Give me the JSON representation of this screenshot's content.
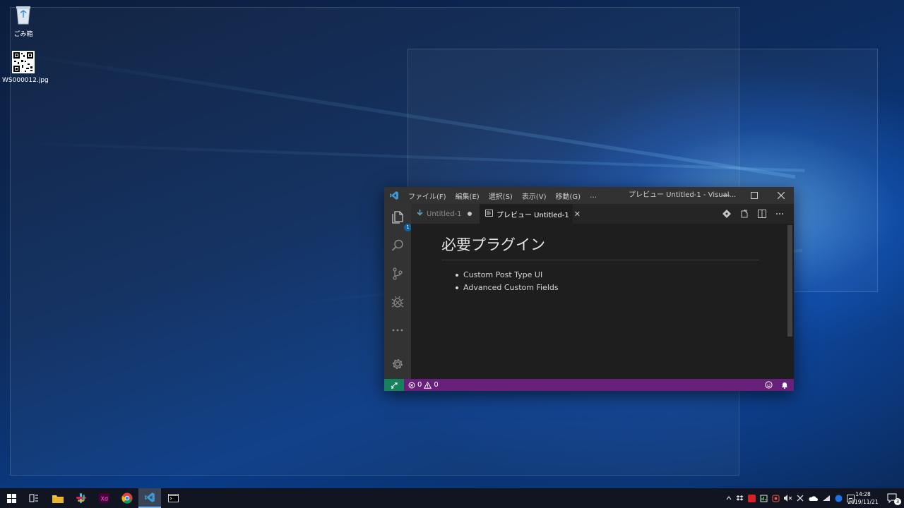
{
  "desktop": {
    "icons": [
      {
        "label": "ごみ箱",
        "icon": "recycle-bin-icon"
      },
      {
        "label": "WS000012.jpg",
        "icon": "qr-image-icon"
      }
    ]
  },
  "vscode": {
    "menu": [
      "ファイル(F)",
      "編集(E)",
      "選択(S)",
      "表示(V)",
      "移動(G)",
      "…"
    ],
    "window_title": "プレビュー Untitled-1 - Visual...",
    "tabs": [
      {
        "label": "Untitled-1",
        "dirty": true
      },
      {
        "label": "プレビュー Untitled-1",
        "active": true
      }
    ],
    "explorer_badge": "1",
    "preview": {
      "heading": "必要プラグイン",
      "items": [
        "Custom Post Type UI",
        "Advanced Custom Fields"
      ]
    },
    "status": {
      "errors": "0",
      "warnings": "0"
    },
    "colors": {
      "statusbar": "#68217a",
      "remote": "#16825d",
      "accent": "#0e639c"
    }
  },
  "taskbar": {
    "clock_time": "14:28",
    "clock_date": "2019/11/21",
    "notification_count": "3"
  }
}
